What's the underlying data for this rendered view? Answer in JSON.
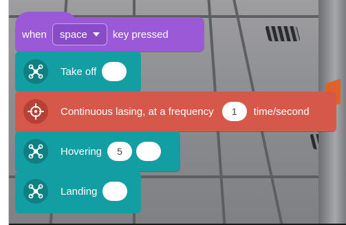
{
  "colors": {
    "event_block": "#9a59d6",
    "motion_block": "#139ea4",
    "laser_block": "#d6584b",
    "input_background": "#ffffff"
  },
  "event_block": {
    "prefix": "when",
    "key_dropdown": "space",
    "suffix": "key pressed"
  },
  "blocks": {
    "takeoff": {
      "label": "Take off",
      "icon": "drone-icon",
      "input": ""
    },
    "laser": {
      "label": "Continuous lasing, at a frequency",
      "icon": "crosshair-icon",
      "frequency": "1",
      "unit": "time/second"
    },
    "hover": {
      "label": "Hovering",
      "icon": "drone-icon",
      "seconds": "5",
      "input2": ""
    },
    "land": {
      "label": "Landing",
      "icon": "drone-icon",
      "input": ""
    }
  }
}
